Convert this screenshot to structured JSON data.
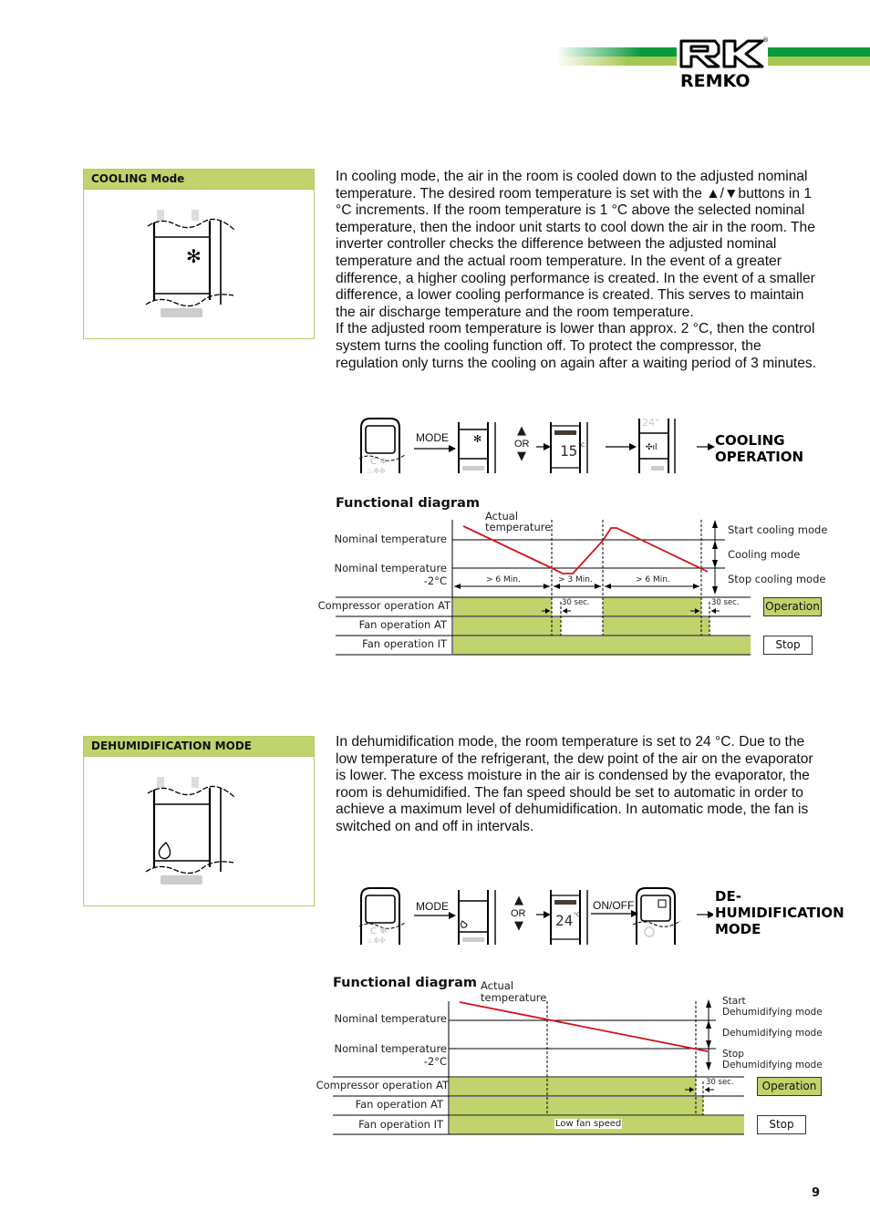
{
  "header": {
    "brand": "REMKO",
    "brand_colors": {
      "green_dark": "#0a9a3c",
      "green_light": "#a5c850"
    }
  },
  "cooling": {
    "box_title": "COOLING Mode",
    "description_p1": "In cooling mode, the air in the room is cooled down to the adjusted nominal temperature. The desired room temperature is set with the ▲/▼buttons in 1 °C increments. If the room temperature is 1 °C above the selected nominal temperature, then the indoor unit starts to cool down the air in the room. The inverter controller checks the difference between the adjusted nominal temperature and the actual room temperature. In the event of a greater difference, a higher cooling performance is created. In the event of a smaller difference, a lower cooling performance is created. This serves to maintain the air discharge temperature and the room temperature.",
    "description_p2": "If the adjusted room temperature is lower than approx. 2 °C, then the control system turns the cooling function off. To protect the compressor, the regulation only turns the cooling on again after a waiting period of 3 minutes.",
    "flow": {
      "step1_label": "MODE",
      "or_label": "OR",
      "display_temp": "15",
      "unit": "°C",
      "result_line1": "COOLING",
      "result_line2": "OPERATION"
    },
    "diagram": {
      "title": "Functional diagram",
      "actual_temp_label_1": "Actual",
      "actual_temp_label_2": "temperature",
      "nominal_label": "Nominal temperature",
      "nominal_minus_label_1": "Nominal temperature",
      "nominal_minus_label_2": "-2°C",
      "interval_1": "> 6 Min.",
      "interval_2": "> 3 Min.",
      "interval_3": "> 6 Min.",
      "delay_label": "30 sec.",
      "rows": [
        "Compressor operation AT",
        "Fan operation AT",
        "Fan operation IT"
      ],
      "right_labels": [
        "Start cooling mode",
        "Cooling mode",
        "Stop cooling mode"
      ],
      "legend_operation": "Operation",
      "legend_stop": "Stop"
    }
  },
  "dehumidification": {
    "box_title": "DEHUMIDIFICATION MODE",
    "description": "In dehumidification mode, the room temperature is set to 24 °C. Due to the low temperature of the refrigerant, the dew point of the air on the evaporator is lower. The excess moisture in the air is condensed by the evaporator, the room is dehumidified. The fan speed should be set to automatic in order to achieve a maximum level of dehumidification. In automatic mode, the fan is switched on and off in intervals.",
    "flow": {
      "step1_label": "MODE",
      "or_label": "OR",
      "display_temp": "24",
      "unit": "°C",
      "step3_label": "ON/OFF",
      "result_line1": "DE-",
      "result_line2": "HUMIDIFICATION",
      "result_line3": "MODE"
    },
    "diagram": {
      "title": "Functional diagram",
      "actual_temp_label_1": "Actual",
      "actual_temp_label_2": "temperature",
      "nominal_label": "Nominal temperature",
      "nominal_minus_label_1": "Nominal temperature",
      "nominal_minus_label_2": "-2°C",
      "delay_label": "30 sec.",
      "low_fan_label": "Low fan speed",
      "rows": [
        "Compressor operation AT",
        "Fan operation AT",
        "Fan operation IT"
      ],
      "right_labels": [
        "Start",
        "Dehumidifying mode",
        "Dehumidifying mode",
        "Stop",
        "Dehumidifying mode"
      ],
      "legend_operation": "Operation",
      "legend_stop": "Stop"
    }
  },
  "page_number": "9"
}
